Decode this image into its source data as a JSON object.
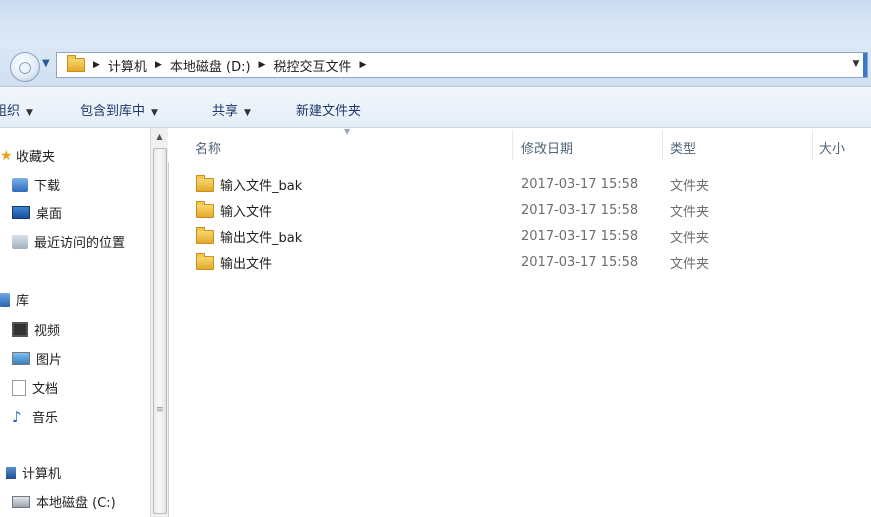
{
  "address": {
    "breadcrumbs": [
      "计算机",
      "本地磁盘 (D:)",
      "税控交互文件"
    ]
  },
  "toolbar": {
    "organize_label": "组织",
    "include_label": "包含到库中",
    "share_label": "共享",
    "new_folder_label": "新建文件夹"
  },
  "nav": {
    "favorites_label": "收藏夹",
    "downloads_label": "下载",
    "desktop_label": "桌面",
    "recent_label": "最近访问的位置",
    "libraries_label": "库",
    "videos_label": "视频",
    "pictures_label": "图片",
    "documents_label": "文档",
    "music_label": "音乐",
    "computer_label": "计算机",
    "drive_c_label": "本地磁盘 (C:)"
  },
  "columns": {
    "name": "名称",
    "date": "修改日期",
    "type": "类型",
    "size": "大小"
  },
  "files": [
    {
      "name": "输入文件_bak",
      "date": "2017-03-17 15:58",
      "type": "文件夹"
    },
    {
      "name": "输入文件",
      "date": "2017-03-17 15:58",
      "type": "文件夹"
    },
    {
      "name": "输出文件_bak",
      "date": "2017-03-17 15:58",
      "type": "文件夹"
    },
    {
      "name": "输出文件",
      "date": "2017-03-17 15:58",
      "type": "文件夹"
    }
  ]
}
